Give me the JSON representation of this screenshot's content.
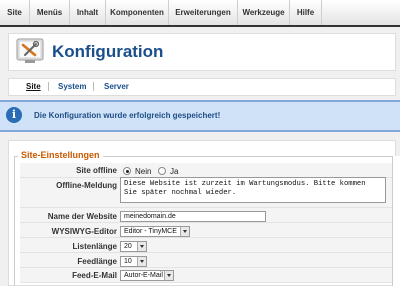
{
  "menu": {
    "items": [
      {
        "label": "Site"
      },
      {
        "label": "Menüs"
      },
      {
        "label": "Inhalt"
      },
      {
        "label": "Komponenten"
      },
      {
        "label": "Erweiterungen"
      },
      {
        "label": "Werkzeuge"
      },
      {
        "label": "Hilfe"
      }
    ]
  },
  "header": {
    "title": "Konfiguration",
    "icon": "config-tools-icon"
  },
  "tabs": [
    {
      "label": "Site",
      "active": true
    },
    {
      "label": "System",
      "active": false
    },
    {
      "label": "Server",
      "active": false
    }
  ],
  "message": {
    "icon": "info-icon",
    "text": "Die Konfiguration wurde erfolgreich gespeichert!"
  },
  "site_settings": {
    "legend": "Site-Einstellungen",
    "site_offline": {
      "label": "Site offline",
      "options": [
        {
          "label": "Nein",
          "checked": true
        },
        {
          "label": "Ja",
          "checked": false
        }
      ]
    },
    "offline_message": {
      "label": "Offline-Meldung",
      "value_line1": "Diese Website ist zurzeit im Wartungsmodus. Bitte kommen",
      "value_line2": "Sie später nochmal wieder."
    },
    "site_name": {
      "label": "Name der Website",
      "value": "meinedomain.de"
    },
    "wysiwyg_editor": {
      "label": "WYSIWYG-Editor",
      "value": "Editor - TinyMCE"
    },
    "list_length": {
      "label": "Listenlänge",
      "value": "20"
    },
    "feed_length": {
      "label": "Feedlänge",
      "value": "10"
    },
    "feed_email": {
      "label": "Feed-E-Mail",
      "value": "Autor-E-Mail"
    }
  },
  "colors": {
    "title": "#1a4f8b",
    "legend": "#c85a00",
    "message_bg": "#cfe2f7",
    "message_text": "#1f4e86"
  }
}
